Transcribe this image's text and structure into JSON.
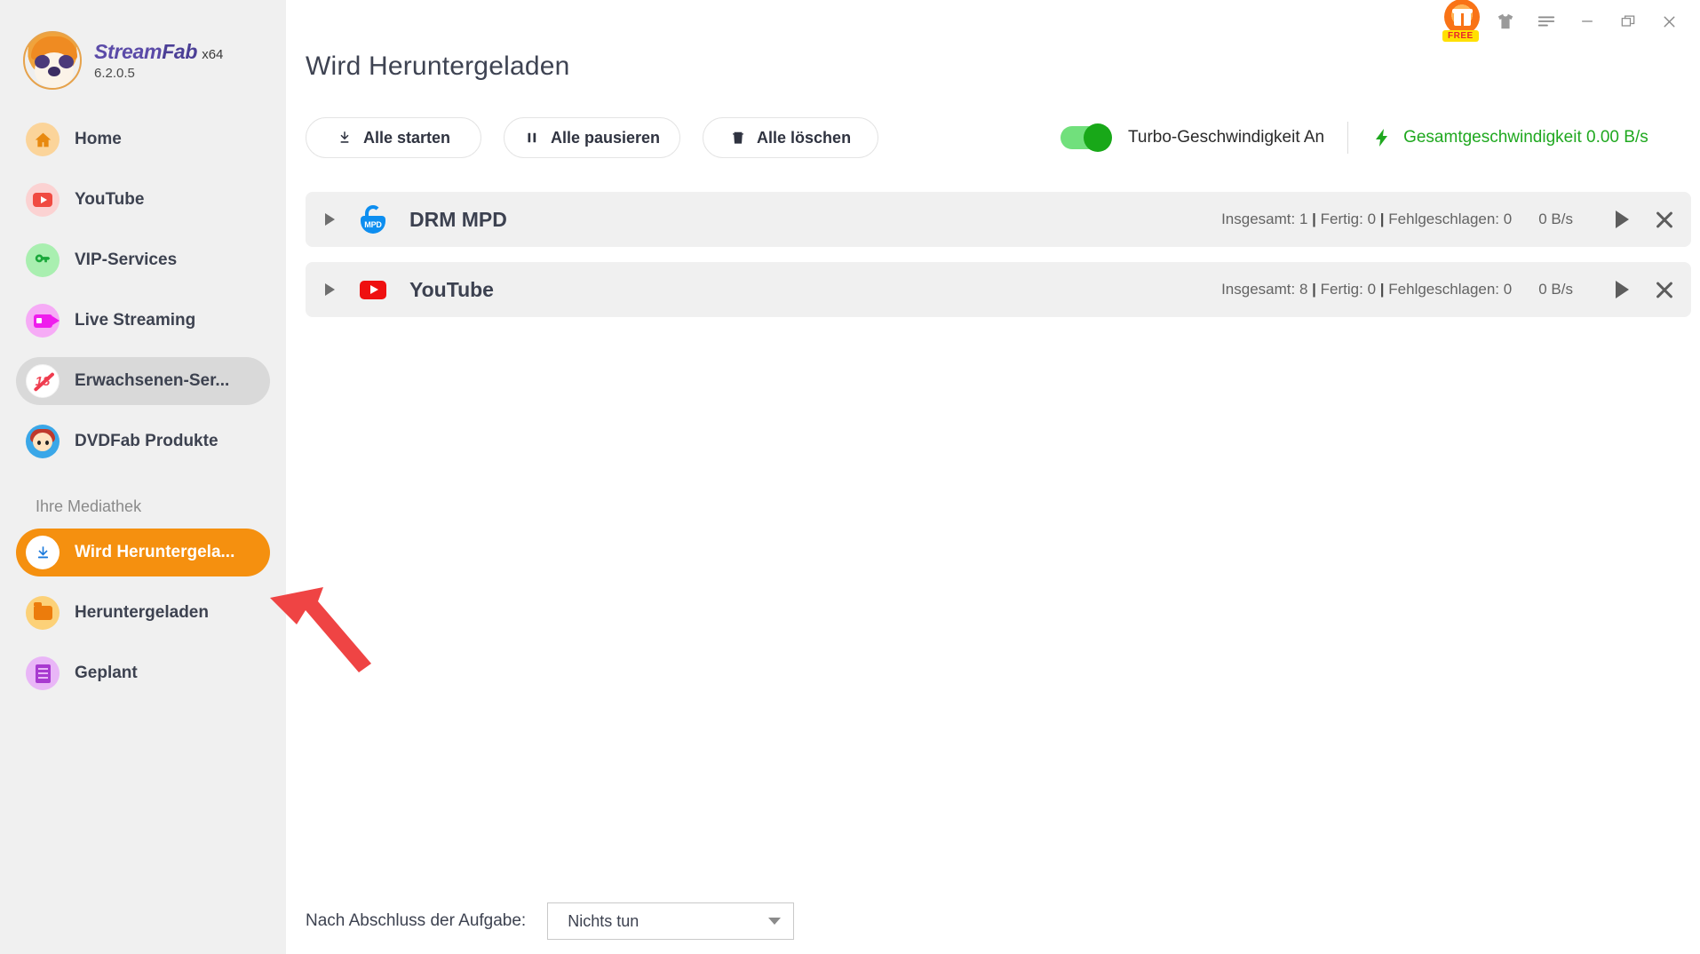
{
  "brand": {
    "name_part1": "Stream",
    "name_part2": "Fab",
    "arch": "x64",
    "version": "6.2.0.5",
    "logo_icon": "sloth-mascot-icon"
  },
  "sidebar": {
    "items": [
      {
        "label": "Home",
        "icon": "home-icon",
        "state": "default"
      },
      {
        "label": "YouTube",
        "icon": "youtube-icon",
        "state": "default"
      },
      {
        "label": "VIP-Services",
        "icon": "key-icon",
        "state": "default"
      },
      {
        "label": "Live Streaming",
        "icon": "video-camera-icon",
        "state": "default"
      },
      {
        "label": "Erwachsenen-Ser...",
        "icon": "adult-18-blocked-icon",
        "state": "hover"
      },
      {
        "label": "DVDFab Produkte",
        "icon": "dvdfab-mascot-icon",
        "state": "default"
      }
    ],
    "section_label": "Ihre Mediathek",
    "library_items": [
      {
        "label": "Wird Heruntergela...",
        "icon": "download-arrow-icon",
        "state": "selected"
      },
      {
        "label": "Heruntergeladen",
        "icon": "folder-icon",
        "state": "default"
      },
      {
        "label": "Geplant",
        "icon": "schedule-list-icon",
        "state": "default"
      }
    ]
  },
  "titlebar": {
    "buttons": [
      {
        "name": "gift-free-icon",
        "glyph": "",
        "badge": "FREE"
      },
      {
        "name": "tshirt-icon",
        "glyph": ""
      },
      {
        "name": "menu-hamburger-icon",
        "glyph": ""
      },
      {
        "name": "minimize-icon",
        "glyph": ""
      },
      {
        "name": "restore-icon",
        "glyph": ""
      },
      {
        "name": "close-icon",
        "glyph": ""
      }
    ]
  },
  "main": {
    "page_title": "Wird Heruntergeladen",
    "toolbar": {
      "start_all": "Alle starten",
      "pause_all": "Alle pausieren",
      "delete_all": "Alle löschen",
      "turbo_label": "Turbo-Geschwindigkeit An",
      "turbo_on": true,
      "total_speed_label": "Gesamtgeschwindigkeit 0.00 B/s"
    },
    "rows": [
      {
        "title": "DRM MPD",
        "icon": "drm-mpd-lock-icon",
        "total_label": "Insgesamt:",
        "total_value": "1",
        "done_label": "Fertig:",
        "done_value": "0",
        "failed_label": "Fehlgeschlagen:",
        "failed_value": "0",
        "speed": "0 B/s"
      },
      {
        "title": "YouTube",
        "icon": "youtube-icon",
        "total_label": "Insgesamt:",
        "total_value": "8",
        "done_label": "Fertig:",
        "done_value": "0",
        "failed_label": "Fehlgeschlagen:",
        "failed_value": "0",
        "speed": "0 B/s"
      }
    ],
    "bottom": {
      "after_task_label": "Nach Abschluss der Aufgabe:",
      "after_task_value": "Nichts tun"
    }
  },
  "annotation": {
    "type": "red-arrow",
    "color": "#ef4444",
    "points_to": "Wird Heruntergela..."
  },
  "colors": {
    "accent_orange": "#f5900f",
    "sidebar_bg": "#f0f0f0",
    "row_bg": "#f0f0f0",
    "green": "#1fa81f",
    "toggle_green": "#18a818",
    "text_dark": "#3d4250"
  }
}
